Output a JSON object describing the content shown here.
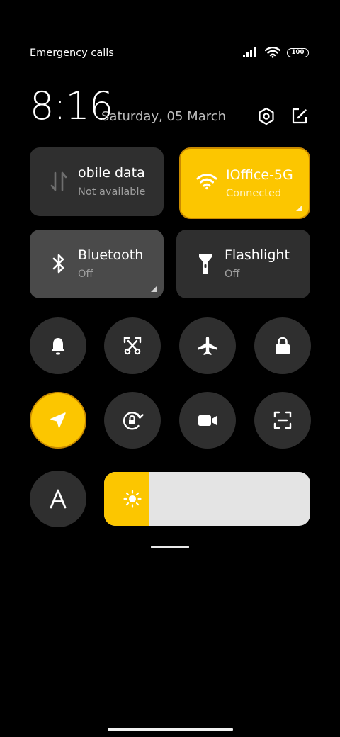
{
  "status_bar": {
    "carrier_text": "Emergency calls o",
    "battery_level": "100",
    "signal_icon": "signal-bars-icon",
    "wifi_icon": "wifi-icon"
  },
  "header": {
    "time": "8:16",
    "date": "Saturday, 05 March",
    "settings_icon": "settings-hexagon-icon",
    "edit_icon": "edit-icon"
  },
  "tiles": [
    {
      "label": "obile data",
      "status": "Not available",
      "active": false,
      "icon": "mobile-data-icon"
    },
    {
      "label": "IOffice-5G",
      "status": "Connected",
      "active": true,
      "icon": "wifi-icon"
    },
    {
      "label": "Bluetooth",
      "status": "Off",
      "active": false,
      "icon": "bluetooth-icon"
    },
    {
      "label": "Flashlight",
      "status": "Off",
      "active": false,
      "icon": "flashlight-icon"
    }
  ],
  "toggles": [
    {
      "name": "bell-icon",
      "active": false
    },
    {
      "name": "screenshot-icon",
      "active": false
    },
    {
      "name": "airplane-icon",
      "active": false
    },
    {
      "name": "lock-icon",
      "active": false
    },
    {
      "name": "location-icon",
      "active": true
    },
    {
      "name": "rotation-lock-icon",
      "active": false
    },
    {
      "name": "video-camera-icon",
      "active": false
    },
    {
      "name": "scanner-icon",
      "active": false
    },
    {
      "name": "font-a-icon",
      "active": false
    }
  ],
  "brightness": {
    "level_fraction": 0.22,
    "icon": "sun-icon"
  },
  "colors": {
    "accent": "#fcc600",
    "tile_bg": "#2f2f2f",
    "tile_bg_light": "#4a4a4a",
    "background": "#000000"
  }
}
